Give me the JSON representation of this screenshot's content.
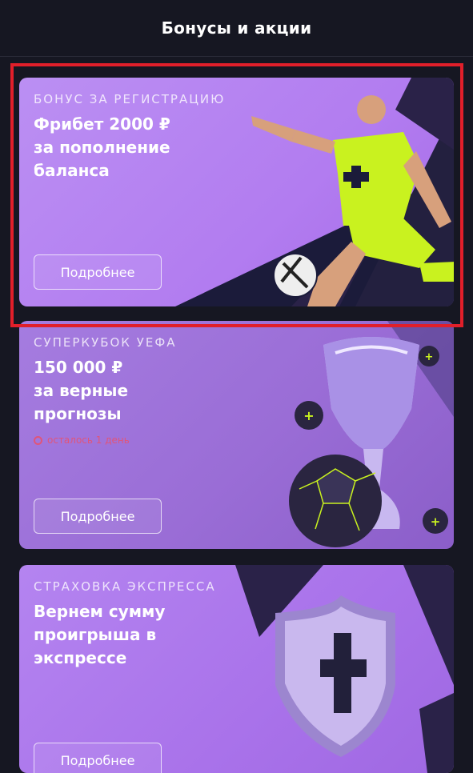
{
  "header": {
    "title": "Бонусы и акции"
  },
  "cards": [
    {
      "eyebrow": "БОНУС ЗА РЕГИСТРАЦИЮ",
      "headline": [
        "Фрибет 2000 ₽",
        "за пополнение",
        "баланса"
      ],
      "button": "Подробнее",
      "art": "football-player"
    },
    {
      "eyebrow": "СУПЕРКУБОК УЕФА",
      "headline": [
        "150 000 ₽",
        "за верные",
        "прогнозы"
      ],
      "timer": "осталось 1 день",
      "button": "Подробнее",
      "art": "trophy-and-ball"
    },
    {
      "eyebrow": "СТРАХОВКА ЭКСПРЕССА",
      "headline": [
        "Вернем сумму",
        "проигрыша в",
        "экспрессе"
      ],
      "button": "Подробнее",
      "art": "shield"
    }
  ],
  "colors": {
    "background": "#161722",
    "highlight": "#e11f2a",
    "accent": "#c5ef22"
  }
}
